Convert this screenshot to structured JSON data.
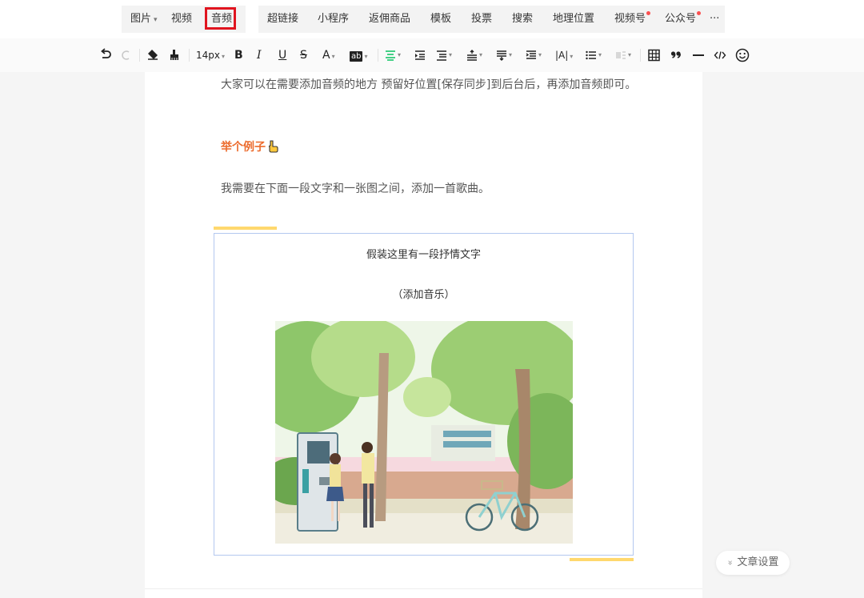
{
  "insert_bar": {
    "items": [
      {
        "label": "图片",
        "dropdown": true,
        "dot": false
      },
      {
        "label": "视频",
        "dropdown": false,
        "dot": false
      },
      {
        "label": "音频",
        "dropdown": false,
        "dot": false,
        "highlighted": true
      },
      {
        "label": "超链接",
        "dropdown": false,
        "dot": false
      },
      {
        "label": "小程序",
        "dropdown": false,
        "dot": false
      },
      {
        "label": "返佣商品",
        "dropdown": false,
        "dot": false
      },
      {
        "label": "模板",
        "dropdown": false,
        "dot": false
      },
      {
        "label": "投票",
        "dropdown": false,
        "dot": false
      },
      {
        "label": "搜索",
        "dropdown": false,
        "dot": false
      },
      {
        "label": "地理位置",
        "dropdown": false,
        "dot": false
      },
      {
        "label": "视频号",
        "dropdown": false,
        "dot": true
      },
      {
        "label": "公众号",
        "dropdown": false,
        "dot": true
      }
    ],
    "more_label": "···",
    "highlight_color": "#e0141f",
    "dot_color": "#fa5151"
  },
  "format_bar": {
    "font_size": "14px",
    "bold_label": "B",
    "italic_label": "I",
    "underline_label": "U",
    "strike_label": "S",
    "color_label": "A",
    "bg_label": "ab",
    "spacing_label": "|A|",
    "accent": "#07c160"
  },
  "article": {
    "intro": "大家可以在需要添加音频的地方 预留好位置[保存同步]到后台后，再添加音频即可。",
    "example_title": "举个例子",
    "example_color": "#ec6b2d",
    "sentence": "我需要在下面一段文字和一张图之间，添加一首歌曲。",
    "card_line1": "假装这里有一段抒情文字",
    "card_line2": "（添加音乐）",
    "accent_bar_color": "#ffd86e",
    "card_border_color": "#b3c8ef"
  },
  "settings_button": {
    "label": "文章设置",
    "icon": "double-chevron-down-icon"
  }
}
